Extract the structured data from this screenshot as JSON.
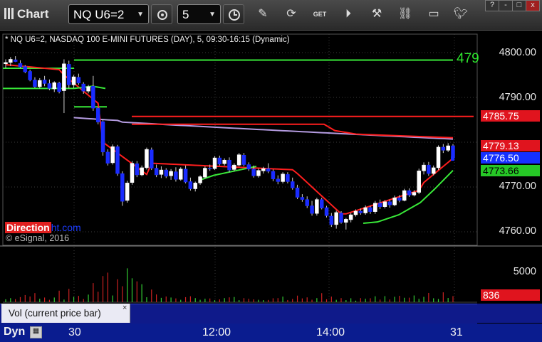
{
  "toolbar": {
    "title": "Chart",
    "symbol": "NQ U6=2",
    "interval": "5",
    "window_buttons": [
      "?",
      "-",
      "□",
      "x"
    ]
  },
  "chart_info": "* NQ U6=2, NASDAQ 100 E-MINI FUTURES (DAY), 5, 09:30-16:15 (Dynamic)",
  "price_scale": [
    "4800.00",
    "4790.00",
    "4770.00",
    "4760.00"
  ],
  "price_tags": {
    "red_line": "4785.75",
    "red_high": "4779.13",
    "last": "4776.50",
    "green_ma": "4773.66",
    "green_big": "479"
  },
  "brand": {
    "part1": "Direction",
    "part2": "ht.com"
  },
  "copyright": "© eSignal, 2016",
  "volume": {
    "pane_title": "Vol (current price bar)",
    "close": "×",
    "scale": "5000",
    "last": "836"
  },
  "time_axis": {
    "mode": "Dyn",
    "labels": [
      "30",
      "12:00",
      "14:00",
      "31"
    ]
  },
  "colors": {
    "bull": "#ffffff",
    "bear": "#1a2cff",
    "red_ma": "#ff1e1e",
    "green_ma": "#38e838",
    "purple": "#b49be0"
  },
  "chart_data": {
    "type": "candlestick",
    "title": "NQ U6=2, NASDAQ 100 E-MINI FUTURES (DAY), 5, 09:30-16:15 (Dynamic)",
    "ylim": [
      4757,
      4802
    ],
    "x_ticks": [
      "30",
      "12:00",
      "14:00",
      "31"
    ],
    "candles": [
      [
        4797.5,
        4798.5,
        4796.5,
        4797.8
      ],
      [
        4797.8,
        4799.0,
        4797.0,
        4798.5
      ],
      [
        4798.4,
        4799.2,
        4797.9,
        4798.0
      ],
      [
        4797.6,
        4798.3,
        4796.5,
        4796.8
      ],
      [
        4796.9,
        4797.2,
        4795.4,
        4795.7
      ],
      [
        4795.8,
        4796.2,
        4793.6,
        4793.9
      ],
      [
        4793.9,
        4794.5,
        4792.1,
        4792.4
      ],
      [
        4792.4,
        4794.3,
        4792.0,
        4793.8
      ],
      [
        4793.9,
        4794.8,
        4792.5,
        4793.1
      ],
      [
        4793.1,
        4794.0,
        4791.6,
        4792.0
      ],
      [
        4791.9,
        4793.6,
        4791.2,
        4793.3
      ],
      [
        4793.2,
        4793.5,
        4790.9,
        4791.3
      ],
      [
        4791.5,
        4798.5,
        4786.5,
        4797.5
      ],
      [
        4797.4,
        4798.2,
        4792.0,
        4792.8
      ],
      [
        4792.8,
        4795.0,
        4792.1,
        4794.6
      ],
      [
        4794.5,
        4795.3,
        4792.8,
        4793.2
      ],
      [
        4793.0,
        4793.4,
        4790.8,
        4791.4
      ],
      [
        4791.4,
        4792.8,
        4790.9,
        4792.4
      ],
      [
        4792.5,
        4794.8,
        4787.0,
        4787.6
      ],
      [
        4787.6,
        4787.9,
        4784.0,
        4784.5
      ],
      [
        4784.6,
        4785.0,
        4777.0,
        4777.8
      ],
      [
        4777.8,
        4778.4,
        4774.8,
        4775.3
      ],
      [
        4775.4,
        4779.5,
        4775.0,
        4779.0
      ],
      [
        4779.0,
        4779.4,
        4772.5,
        4773.0
      ],
      [
        4773.0,
        4773.5,
        4765.8,
        4766.8
      ],
      [
        4767.0,
        4771.4,
        4766.5,
        4770.9
      ],
      [
        4771.0,
        4775.8,
        4770.5,
        4775.3
      ],
      [
        4775.2,
        4775.8,
        4772.2,
        4772.7
      ],
      [
        4772.7,
        4774.8,
        4772.4,
        4774.3
      ],
      [
        4774.3,
        4778.8,
        4773.9,
        4778.4
      ],
      [
        4778.3,
        4778.8,
        4773.8,
        4774.2
      ],
      [
        4774.2,
        4775.0,
        4772.2,
        4772.7
      ],
      [
        4772.8,
        4774.6,
        4772.0,
        4773.8
      ],
      [
        4773.8,
        4774.2,
        4772.0,
        4772.4
      ],
      [
        4772.5,
        4774.0,
        4771.6,
        4773.5
      ],
      [
        4773.4,
        4774.4,
        4771.2,
        4771.7
      ],
      [
        4771.7,
        4774.4,
        4771.4,
        4774.0
      ],
      [
        4774.0,
        4774.8,
        4770.8,
        4771.1
      ],
      [
        4771.2,
        4772.1,
        4769.2,
        4769.6
      ],
      [
        4769.6,
        4771.2,
        4769.0,
        4770.9
      ],
      [
        4770.9,
        4772.6,
        4770.5,
        4772.3
      ],
      [
        4772.2,
        4774.6,
        4771.9,
        4774.2
      ],
      [
        4774.2,
        4775.0,
        4773.6,
        4774.1
      ],
      [
        4774.1,
        4776.9,
        4773.8,
        4776.5
      ],
      [
        4776.5,
        4777.0,
        4774.8,
        4775.1
      ],
      [
        4775.2,
        4776.4,
        4774.8,
        4776.0
      ],
      [
        4776.0,
        4776.6,
        4773.3,
        4773.8
      ],
      [
        4773.9,
        4775.3,
        4773.5,
        4774.9
      ],
      [
        4774.9,
        4777.6,
        4774.6,
        4777.2
      ],
      [
        4777.1,
        4777.6,
        4774.6,
        4775.0
      ],
      [
        4775.0,
        4775.5,
        4773.6,
        4774.0
      ],
      [
        4774.0,
        4774.8,
        4772.1,
        4772.5
      ],
      [
        4772.5,
        4774.1,
        4772.1,
        4773.7
      ],
      [
        4773.6,
        4774.5,
        4773.0,
        4774.1
      ],
      [
        4774.1,
        4775.3,
        4773.1,
        4773.5
      ],
      [
        4773.5,
        4773.9,
        4771.3,
        4771.8
      ],
      [
        4771.8,
        4772.6,
        4770.6,
        4771.2
      ],
      [
        4771.2,
        4773.3,
        4770.8,
        4772.9
      ],
      [
        4772.8,
        4773.3,
        4770.8,
        4771.2
      ],
      [
        4771.2,
        4772.1,
        4769.4,
        4769.8
      ],
      [
        4769.8,
        4770.5,
        4767.3,
        4767.7
      ],
      [
        4767.7,
        4768.4,
        4766.7,
        4767.2
      ],
      [
        4767.2,
        4767.9,
        4765.3,
        4765.8
      ],
      [
        4765.8,
        4766.9,
        4763.6,
        4764.1
      ],
      [
        4764.1,
        4767.6,
        4763.6,
        4767.2
      ],
      [
        4767.2,
        4767.6,
        4765.0,
        4765.3
      ],
      [
        4765.4,
        4765.8,
        4763.2,
        4763.6
      ],
      [
        4763.5,
        4764.2,
        4761.1,
        4761.6
      ],
      [
        4761.6,
        4764.7,
        4760.7,
        4764.3
      ],
      [
        4764.2,
        4764.6,
        4761.8,
        4762.1
      ],
      [
        4762.1,
        4763.1,
        4760.5,
        4762.8
      ],
      [
        4762.7,
        4764.2,
        4762.1,
        4763.8
      ],
      [
        4763.8,
        4765.0,
        4763.4,
        4764.6
      ],
      [
        4764.6,
        4765.2,
        4763.8,
        4764.2
      ],
      [
        4764.2,
        4765.9,
        4763.8,
        4765.4
      ],
      [
        4765.4,
        4765.8,
        4764.0,
        4764.5
      ],
      [
        4764.5,
        4766.9,
        4764.0,
        4766.4
      ],
      [
        4766.4,
        4767.2,
        4765.1,
        4765.6
      ],
      [
        4765.6,
        4767.1,
        4765.2,
        4766.7
      ],
      [
        4766.7,
        4767.2,
        4765.4,
        4766.0
      ],
      [
        4766.0,
        4768.1,
        4765.7,
        4767.6
      ],
      [
        4767.6,
        4768.2,
        4766.6,
        4767.0
      ],
      [
        4767.0,
        4769.6,
        4766.8,
        4769.2
      ],
      [
        4769.2,
        4769.7,
        4767.8,
        4768.2
      ],
      [
        4768.2,
        4769.3,
        4767.9,
        4768.8
      ],
      [
        4768.8,
        4774.1,
        4768.4,
        4773.6
      ],
      [
        4773.6,
        4775.5,
        4772.8,
        4774.9
      ],
      [
        4774.9,
        4775.6,
        4772.5,
        4773.0
      ],
      [
        4773.0,
        4774.8,
        4772.6,
        4774.3
      ],
      [
        4774.3,
        4779.3,
        4773.8,
        4778.9
      ],
      [
        4778.9,
        4779.6,
        4777.6,
        4778.2
      ],
      [
        4778.2,
        4779.8,
        4777.8,
        4779.2
      ],
      [
        4779.2,
        4779.6,
        4776.3,
        4776.5
      ]
    ],
    "volume": [
      400,
      560,
      420,
      700,
      980,
      780,
      1250,
      460,
      640,
      330,
      640,
      1580,
      360,
      1820,
      730,
      860,
      430,
      1040,
      2620,
      1430,
      3580,
      4050,
      920,
      3140,
      2180,
      4640,
      3280,
      2850,
      2460,
      680,
      1730,
      1060,
      600,
      780,
      640,
      520,
      330,
      690,
      810,
      560,
      330,
      470,
      510,
      280,
      380,
      560,
      660,
      710,
      290,
      560,
      460,
      380,
      330,
      290,
      310,
      540,
      560,
      760,
      300,
      440,
      900,
      520,
      660,
      340,
      560,
      1240,
      400,
      760,
      330,
      560,
      290,
      540,
      210,
      560,
      470,
      540,
      810,
      360,
      830,
      370,
      740,
      870,
      610,
      620,
      920,
      460,
      730,
      1270,
      540,
      430,
      1350,
      580,
      836
    ],
    "volume_ylim": [
      0,
      7500
    ],
    "lines": {
      "red_flat": 4785.75,
      "green_top": 4798.5,
      "green_mid": 4792.0
    }
  }
}
